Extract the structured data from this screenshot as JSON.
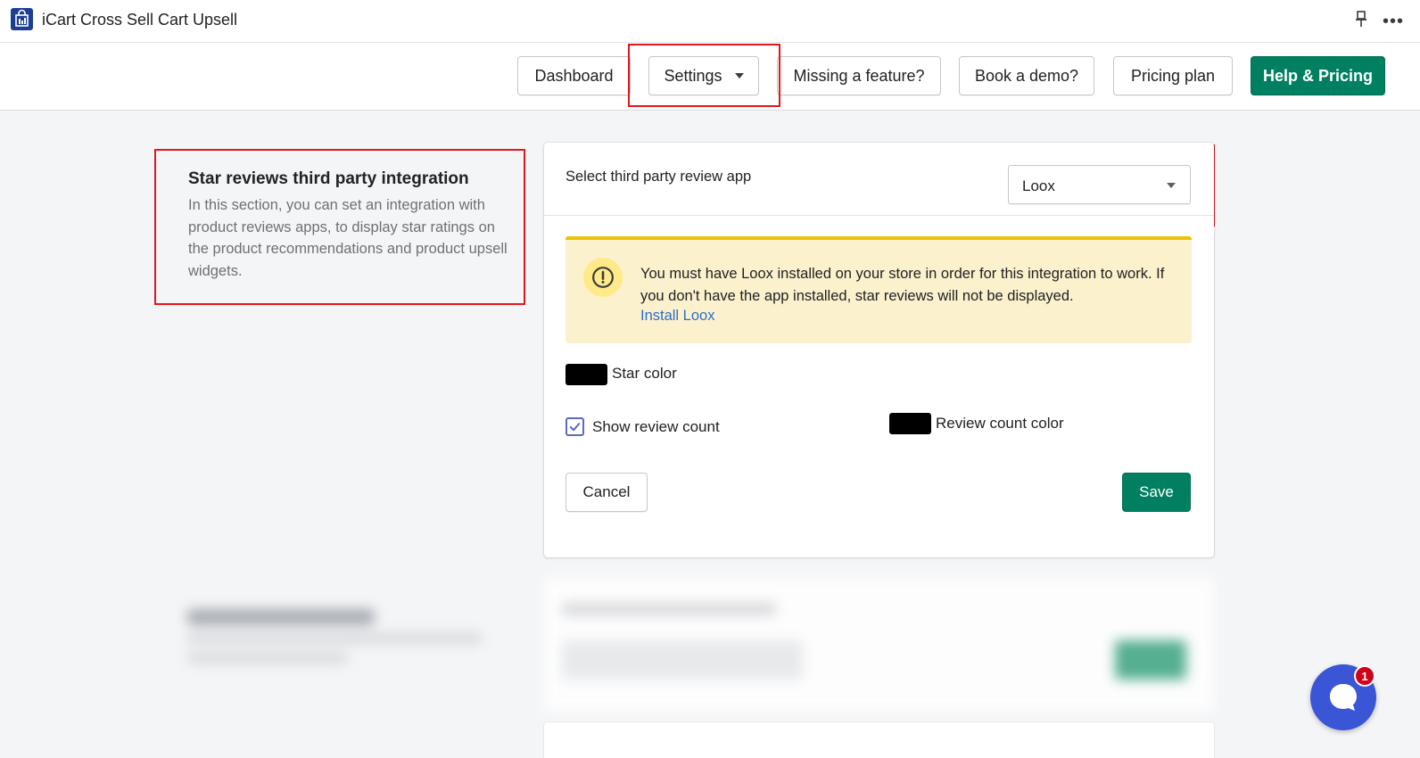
{
  "app": {
    "title": "iCart Cross Sell Cart Upsell",
    "more_label": "•••"
  },
  "nav": {
    "dashboard": "Dashboard",
    "settings": "Settings",
    "missing_feature": "Missing a feature?",
    "book_demo": "Book a demo?",
    "pricing_plan": "Pricing plan",
    "help_pricing": "Help & Pricing"
  },
  "section": {
    "title": "Star reviews third party integration",
    "description": "In this section, you can set an integration with product reviews apps, to display star ratings on the product recommendations and product upsell widgets."
  },
  "card": {
    "select_label": "Select third party review app",
    "select_value": "Loox",
    "banner_text": "You must have Loox installed on your store in order for this integration to work. If you don't have the app installed, star reviews will not be displayed.",
    "banner_link": "Install Loox",
    "star_color_label": "Star color",
    "show_review_count_label": "Show review count",
    "show_review_count_checked": true,
    "review_count_color_label": "Review count color",
    "cancel_label": "Cancel",
    "save_label": "Save"
  },
  "chat": {
    "badge_count": "1"
  },
  "colors": {
    "primary": "#008060",
    "annotation": "#e3161b",
    "banner_bg": "#fcf1cd",
    "banner_border": "#eec200",
    "link": "#2c6ecb",
    "star_color": "#000000",
    "review_count_color": "#000000",
    "chat": "#3a56d6"
  }
}
